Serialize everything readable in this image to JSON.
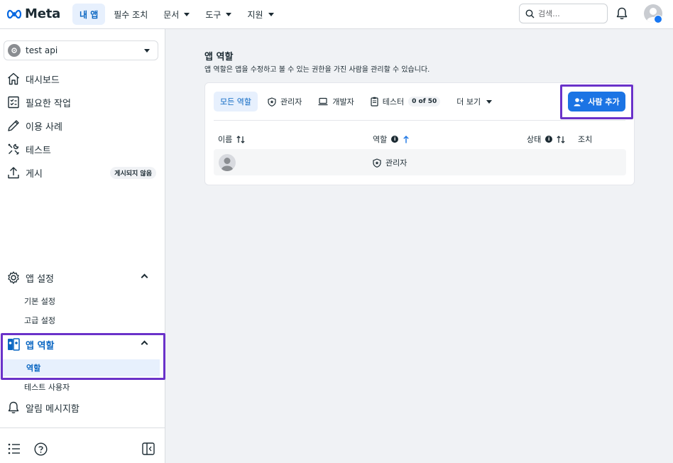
{
  "header": {
    "logo_text": "Meta",
    "nav": [
      {
        "label": "내 앱",
        "active": true,
        "dropdown": false
      },
      {
        "label": "필수 조치",
        "active": false,
        "dropdown": false
      },
      {
        "label": "문서",
        "active": false,
        "dropdown": true
      },
      {
        "label": "도구",
        "active": false,
        "dropdown": true
      },
      {
        "label": "지원",
        "active": false,
        "dropdown": true
      }
    ],
    "search_placeholder": "검색..."
  },
  "sidebar": {
    "app_name": "test api",
    "items": [
      {
        "label": "대시보드",
        "icon": "home-icon"
      },
      {
        "label": "필요한 작업",
        "icon": "checklist-icon"
      },
      {
        "label": "이용 사례",
        "icon": "pencil-icon"
      },
      {
        "label": "테스트",
        "icon": "tools-icon"
      },
      {
        "label": "게시",
        "icon": "upload-icon",
        "badge": "게시되지 않음"
      }
    ],
    "app_settings": {
      "label": "앱 설정",
      "icon": "gear-icon",
      "children": [
        "기본 설정",
        "고급 설정"
      ]
    },
    "app_roles": {
      "label": "앱 역할",
      "icon": "app-roles-icon",
      "children": [
        "역할",
        "테스트 사용자"
      ]
    },
    "notifications": {
      "label": "알림 메시지함",
      "icon": "bell-icon"
    }
  },
  "main": {
    "title": "앱 역할",
    "description": "앱 역할은 앱을 수정하고 볼 수 있는 권한을 가진 사람을 관리할 수 있습니다.",
    "tabs": [
      {
        "label": "모든 역할",
        "active": true
      },
      {
        "label": "관리자",
        "icon": "shield-icon"
      },
      {
        "label": "개발자",
        "icon": "laptop-icon"
      },
      {
        "label": "테스터",
        "icon": "clipboard-icon",
        "count": "0 of 50"
      },
      {
        "label": "더 보기",
        "dropdown": true
      }
    ],
    "add_button": "사람 추가",
    "table": {
      "headers": [
        "이름",
        "역할",
        "상태",
        "조치"
      ],
      "rows": [
        {
          "name": "",
          "role": "관리자"
        }
      ]
    }
  },
  "colors": {
    "accent": "#1b74e4",
    "active_bg": "#e7f0fd",
    "highlight": "#6a32c9"
  }
}
